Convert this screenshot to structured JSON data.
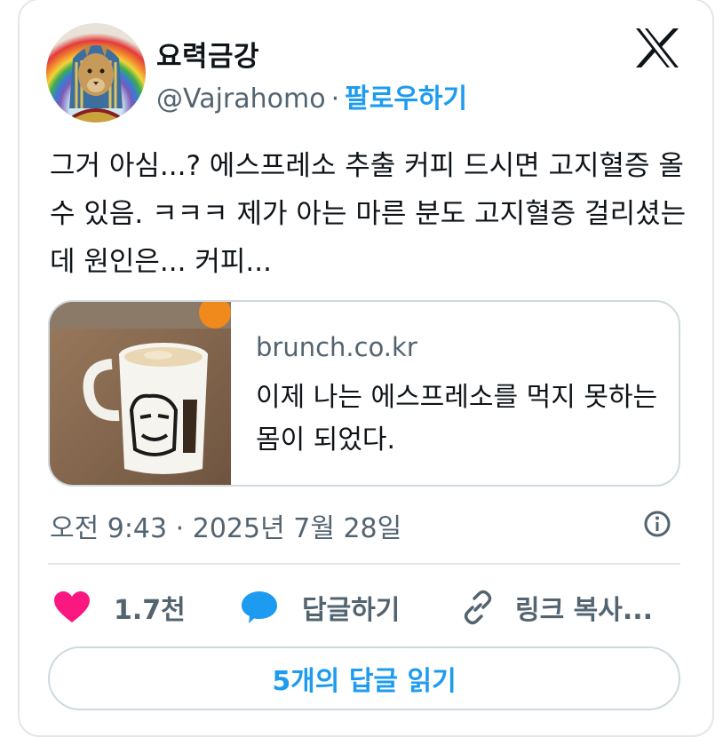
{
  "author": {
    "display_name": "요력금강",
    "handle": "@Vajrahomo",
    "separator": "·",
    "follow_label": "팔로우하기"
  },
  "tweet": {
    "text": "그거 아심...? 에스프레소 추출 커피 드시면 고지혈증 올 수 있음. ㅋㅋㅋ 제가 아는 마른 분도 고지혈증 걸리셨는데 원인은... 커피..."
  },
  "link_card": {
    "domain": "brunch.co.kr",
    "title": "이제 나는 에스프레소를 먹지 못하는 몸이 되었다."
  },
  "meta": {
    "time": "오전 9:43",
    "separator": "·",
    "date": "2025년 7월 28일"
  },
  "actions": {
    "like_count": "1.7천",
    "reply_label": "답글하기",
    "copy_link_label": "링크 복사..."
  },
  "read_replies_label": "5개의 답글 읽기",
  "icons": {
    "platform": "x-logo-icon",
    "info": "info-icon",
    "like": "heart-icon",
    "reply": "speech-bubble-icon",
    "copy": "link-icon"
  },
  "colors": {
    "accent": "#1d9bf0",
    "like": "#f91880",
    "muted": "#536471",
    "text": "#0f1419",
    "border": "#cfd9de"
  }
}
